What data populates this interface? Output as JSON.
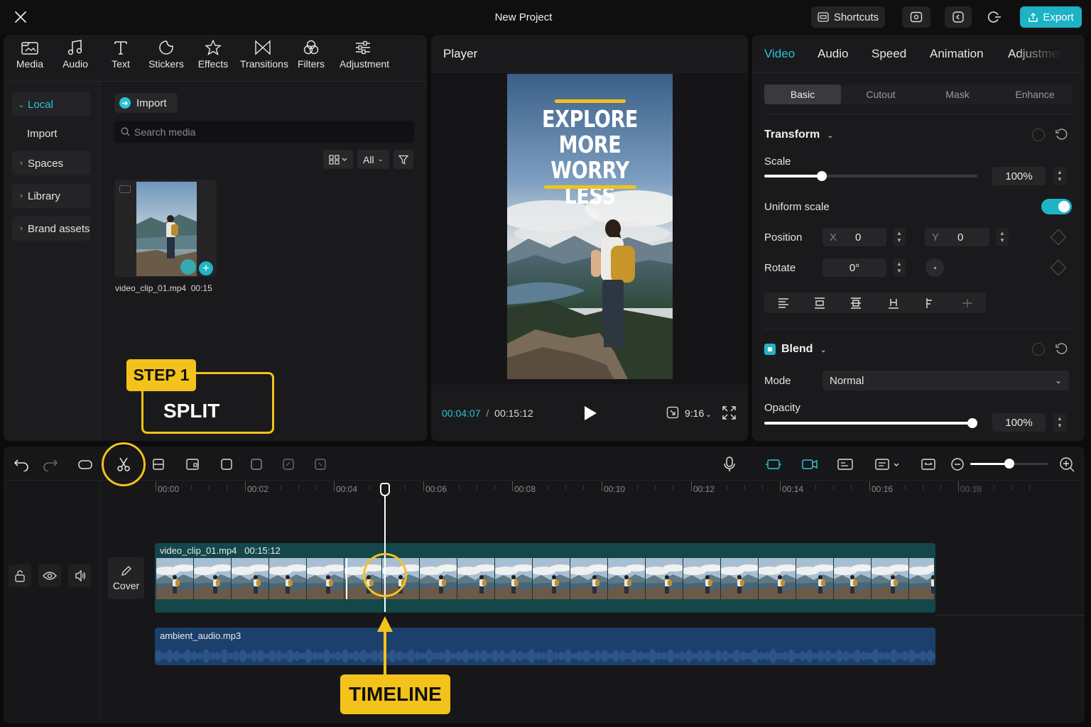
{
  "app": {
    "title": "New Project",
    "shortcuts_label": "Shortcuts",
    "export_label": "Export",
    "accent": "#2bc4d6"
  },
  "media_panel": {
    "tools": [
      {
        "label": "Media",
        "icon": "media-icon"
      },
      {
        "label": "Audio",
        "icon": "music-note-icon"
      },
      {
        "label": "Text",
        "icon": "text-icon"
      },
      {
        "label": "Stickers",
        "icon": "sticker-icon"
      },
      {
        "label": "Effects",
        "icon": "star-icon"
      },
      {
        "label": "Transitions",
        "icon": "transition-icon"
      },
      {
        "label": "Filters",
        "icon": "filter-icon"
      },
      {
        "label": "Adjustment",
        "icon": "sliders-icon"
      }
    ],
    "nav": {
      "local": "Local",
      "import": "Import",
      "spaces": "Spaces",
      "library": "Library",
      "brand_assets": "Brand assets"
    },
    "import_button": "Import",
    "search_placeholder": "Search media",
    "filter_all": "All",
    "clip": {
      "name": "video_clip_01.mp4",
      "duration": "00:15"
    }
  },
  "player": {
    "title": "Player",
    "overlay_lines": [
      "EXPLORE",
      "MORE",
      "WORRY LESS"
    ],
    "current_time": "00:04:07",
    "separator": "/",
    "total_time": "00:15:12",
    "aspect": "9:16"
  },
  "properties": {
    "tabs": [
      "Video",
      "Audio",
      "Speed",
      "Animation",
      "Adjustment"
    ],
    "active_tab": "Video",
    "subtabs": [
      "Basic",
      "Cutout",
      "Mask",
      "Enhance"
    ],
    "active_subtab": "Basic",
    "transform_title": "Transform",
    "scale_label": "Scale",
    "scale_value": "100%",
    "scale_fraction": 0.27,
    "uniform_scale_label": "Uniform scale",
    "uniform_scale_on": true,
    "position_label": "Position",
    "x_label": "X",
    "x_value": "0",
    "y_label": "Y",
    "y_value": "0",
    "rotate_label": "Rotate",
    "rotate_value": "0°",
    "blend_title": "Blend",
    "mode_label": "Mode",
    "mode_value": "Normal",
    "opacity_label": "Opacity",
    "opacity_value": "100%",
    "opacity_fraction": 1.0
  },
  "timeline": {
    "ticks": [
      "00:00",
      "00:02",
      "00:04",
      "00:06",
      "00:08",
      "00:10",
      "00:12",
      "00:14",
      "00:16",
      "00:18"
    ],
    "video_track": {
      "name": "video_clip_01.mp4",
      "duration": "00:15:12"
    },
    "audio_track": {
      "name": "ambient_audio.mp3"
    },
    "cover_label": "Cover",
    "zoom_fraction": 0.5
  },
  "callouts": {
    "step": "STEP 1",
    "split": "SPLIT",
    "timeline": "TIMELINE",
    "color": "#f3c21b"
  }
}
